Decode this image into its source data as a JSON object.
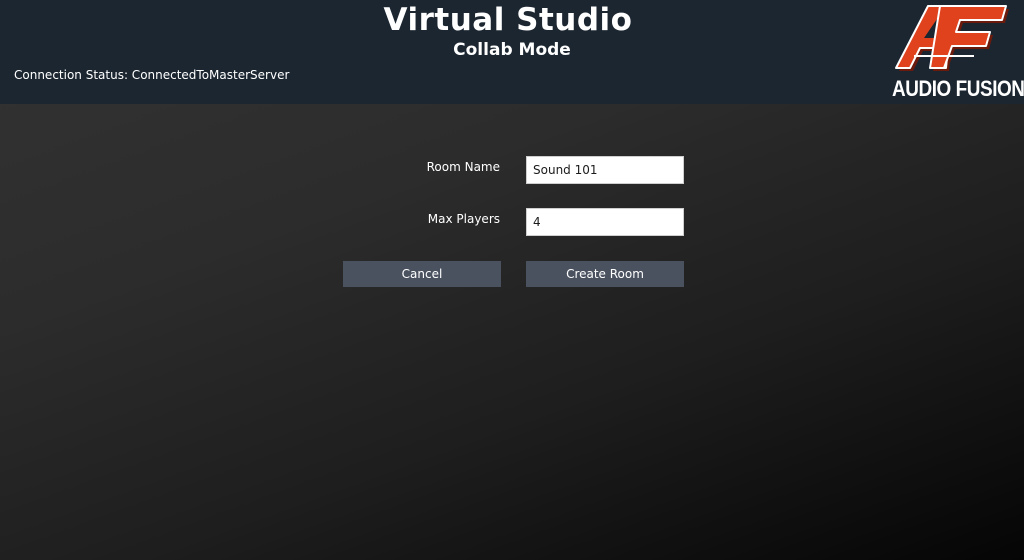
{
  "header": {
    "title": "Virtual Studio",
    "subtitle": "Collab Mode",
    "connection_status": "Connection Status: ConnectedToMasterServer"
  },
  "logo": {
    "monogram": "AF",
    "name": "AUDIO FUSION",
    "colors": {
      "fill": "#e0421d",
      "outline": "#ffffff",
      "shadow": "#6b1a0c"
    },
    "icon": "audio-fusion-logo-icon"
  },
  "form": {
    "room_name_label": "Room Name",
    "room_name_value": "Sound 101",
    "max_players_label": "Max Players",
    "max_players_value": "4"
  },
  "buttons": {
    "cancel_label": "Cancel",
    "create_label": "Create Room"
  },
  "colors": {
    "header_bg": "#1b2631",
    "button_bg": "#4a5260",
    "page_bg": "#2c2c2c"
  }
}
